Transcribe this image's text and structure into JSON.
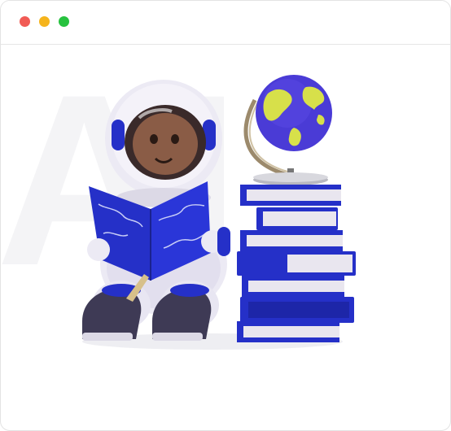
{
  "window": {
    "controls": [
      {
        "name": "close",
        "color": "#f15b55"
      },
      {
        "name": "minimize",
        "color": "#f5b41c"
      },
      {
        "name": "maximize",
        "color": "#27c23f"
      }
    ]
  },
  "illustration": {
    "watermark_text": "AI",
    "subject": "astronaut-reading-book-icon",
    "globe": "globe-icon",
    "books": "book-stack-icon",
    "colors": {
      "book_blue": "#2530c8",
      "globe_blue": "#4a3bd6",
      "land_yellow": "#d7e04a",
      "suit_white": "#eceaf4",
      "visor_dark": "#3a2a2a",
      "boot_dark": "#3e3a55"
    }
  }
}
